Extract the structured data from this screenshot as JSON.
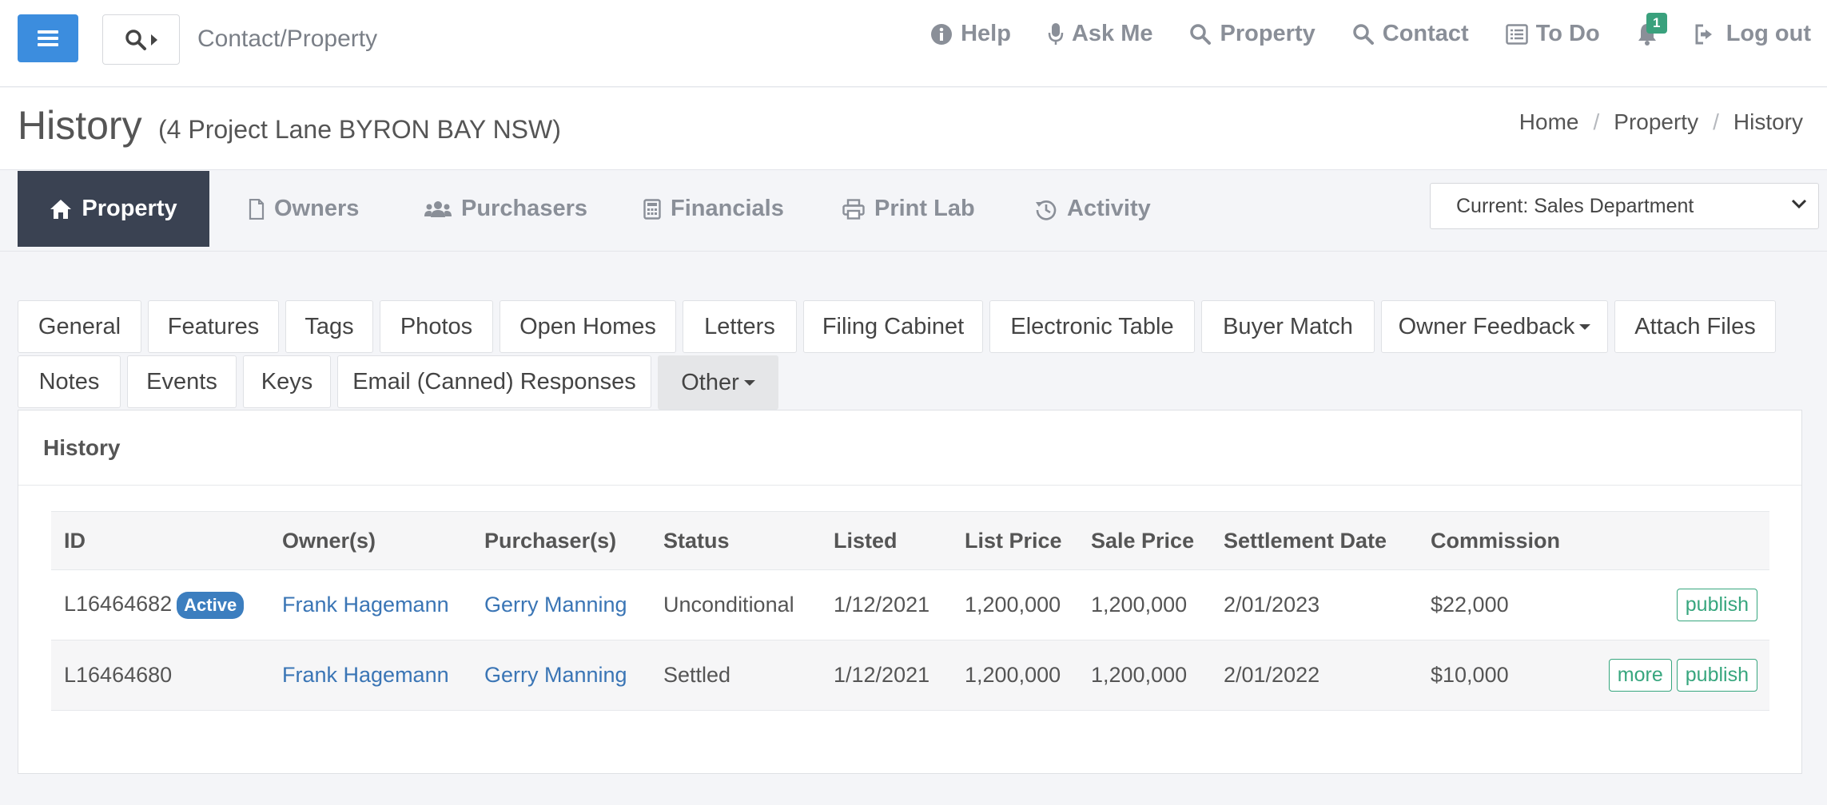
{
  "topbar": {
    "search_label": "Contact/Property",
    "nav": [
      {
        "label": "Help",
        "icon": "info-circle-icon"
      },
      {
        "label": "Ask Me",
        "icon": "microphone-icon"
      },
      {
        "label": "Property",
        "icon": "search-icon"
      },
      {
        "label": "Contact",
        "icon": "search-icon"
      },
      {
        "label": "To Do",
        "icon": "list-icon"
      },
      {
        "label": "",
        "icon": "bell-icon",
        "badge": "1"
      },
      {
        "label": "Log out",
        "icon": "sign-out-icon"
      }
    ]
  },
  "header": {
    "title": "History",
    "subtitle": "(4 Project Lane BYRON BAY NSW)",
    "breadcrumb": [
      "Home",
      "Property",
      "History"
    ]
  },
  "main_tabs": [
    {
      "label": "Property",
      "icon": "home-icon",
      "active": true
    },
    {
      "label": "Owners",
      "icon": "file-icon"
    },
    {
      "label": "Purchasers",
      "icon": "users-icon"
    },
    {
      "label": "Financials",
      "icon": "calculator-icon"
    },
    {
      "label": "Print Lab",
      "icon": "printer-icon"
    },
    {
      "label": "Activity",
      "icon": "history-icon"
    }
  ],
  "department_select": {
    "value": "Current: Sales Department"
  },
  "sub_tabs": {
    "row1": [
      "General",
      "Features",
      "Tags",
      "Photos",
      "Open Homes",
      "Letters",
      "Filing Cabinet",
      "Electronic Table",
      "Buyer Match",
      "Owner Feedback",
      "Attach Files"
    ],
    "row2": [
      "Notes",
      "Events",
      "Keys",
      "Email (Canned) Responses",
      "Other"
    ]
  },
  "panel": {
    "title": "History",
    "columns": [
      "ID",
      "Owner(s)",
      "Purchaser(s)",
      "Status",
      "Listed",
      "List Price",
      "Sale Price",
      "Settlement Date",
      "Commission"
    ],
    "rows": [
      {
        "id": "L16464682",
        "badge": "Active",
        "owner": "Frank Hagemann",
        "purchaser": "Gerry Manning",
        "status": "Unconditional",
        "listed": "1/12/2021",
        "list_price": "1,200,000",
        "sale_price": "1,200,000",
        "settlement": "2/01/2023",
        "commission": "$22,000",
        "actions": [
          "publish"
        ]
      },
      {
        "id": "L16464680",
        "owner": "Frank Hagemann",
        "purchaser": "Gerry Manning",
        "status": "Settled",
        "listed": "1/12/2021",
        "list_price": "1,200,000",
        "sale_price": "1,200,000",
        "settlement": "2/01/2022",
        "commission": "$10,000",
        "actions": [
          "more",
          "publish"
        ]
      }
    ]
  },
  "colors": {
    "primary": "#3c8dde",
    "active_tab_bg": "#3a4252",
    "link": "#3a75b5",
    "success": "#37a67e",
    "badge_active": "#3c7ebf"
  }
}
